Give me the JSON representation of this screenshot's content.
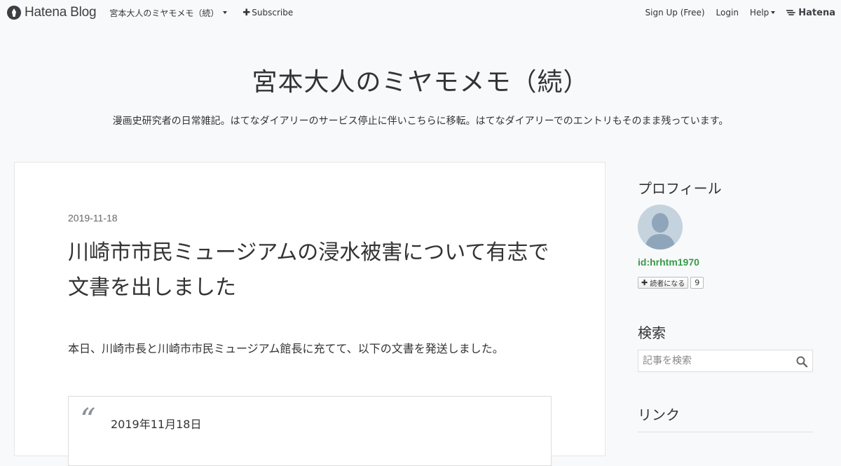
{
  "topbar": {
    "brand": "Hatena Blog",
    "blog_switch": "宮本大人のミヤモメモ（続）",
    "subscribe": "Subscribe",
    "signup": "Sign Up (Free)",
    "login": "Login",
    "help": "Help",
    "hatena": "Hatena"
  },
  "header": {
    "title": "宮本大人のミヤモメモ（続）",
    "description": "漫画史研究者の日常雑記。はてなダイアリーのサービス停止に伴いこちらに移転。はてなダイアリーでのエントリもそのまま残っています。"
  },
  "entry": {
    "date": "2019-11-18",
    "title": "川崎市市民ミュージアムの浸水被害について有志で文書を出しました",
    "body": "本日、川崎市長と川崎市市民ミュージアム館長に充てて、以下の文書を発送しました。",
    "quote_mark": "“",
    "quote_text": "2019年11月18日"
  },
  "sidebar": {
    "profile_title": "プロフィール",
    "profile_id": "id:hrhtm1970",
    "reader_button": "読者になる",
    "reader_count": "9",
    "search_title": "検索",
    "search_placeholder": "記事を検索",
    "links_title": "リンク"
  },
  "colors": {
    "background": "#f8f9fa",
    "profile_id": "#3a9a4a",
    "text": "#333333"
  }
}
